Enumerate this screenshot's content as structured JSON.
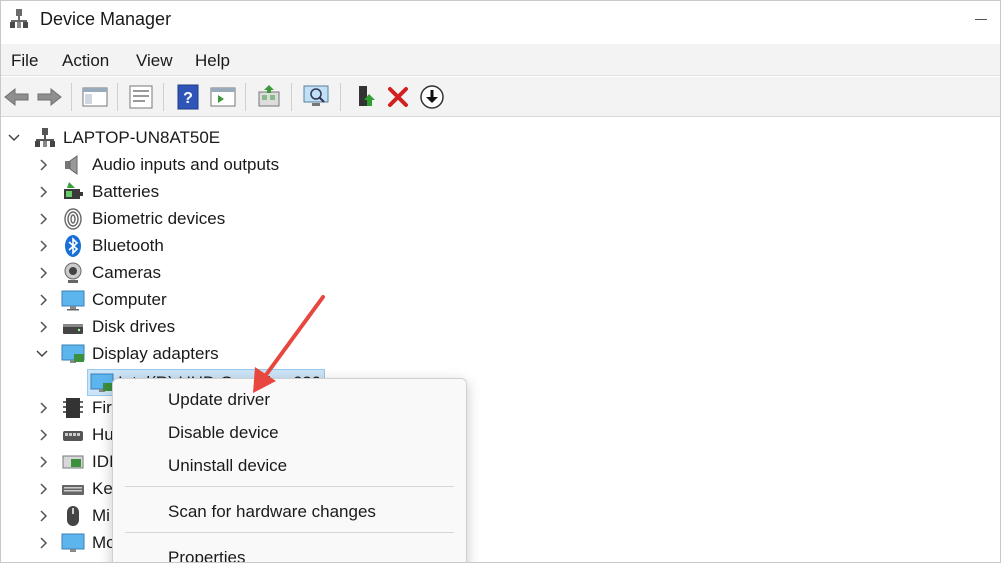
{
  "window": {
    "title": "Device Manager"
  },
  "menubar": {
    "items": [
      "File",
      "Action",
      "View",
      "Help"
    ]
  },
  "toolbar": {
    "buttons": [
      "back-icon",
      "forward-icon",
      "show-hide-console-tree-icon",
      "properties-icon",
      "help-icon",
      "action-pane-icon",
      "update-driver-software-icon",
      "scan-hardware-icon",
      "enable-device-icon",
      "uninstall-device-icon",
      "download-icon"
    ]
  },
  "tree": {
    "root": "LAPTOP-UN8AT50E",
    "categories": [
      {
        "label": "Audio inputs and outputs",
        "icon": "speaker-icon",
        "expanded": false
      },
      {
        "label": "Batteries",
        "icon": "battery-icon",
        "expanded": false
      },
      {
        "label": "Biometric devices",
        "icon": "fingerprint-icon",
        "expanded": false
      },
      {
        "label": "Bluetooth",
        "icon": "bluetooth-icon",
        "expanded": false
      },
      {
        "label": "Cameras",
        "icon": "camera-icon",
        "expanded": false
      },
      {
        "label": "Computer",
        "icon": "monitor-icon",
        "expanded": false
      },
      {
        "label": "Disk drives",
        "icon": "disk-drive-icon",
        "expanded": false
      },
      {
        "label": "Display adapters",
        "icon": "display-adapter-icon",
        "expanded": true
      },
      {
        "label": "Fir",
        "icon": "firmware-icon",
        "expanded": false
      },
      {
        "label": "Hu",
        "icon": "human-interface-icon",
        "expanded": false
      },
      {
        "label": "IDI",
        "icon": "ide-controller-icon",
        "expanded": false
      },
      {
        "label": "Ke",
        "icon": "keyboard-icon",
        "expanded": false
      },
      {
        "label": "Mi",
        "icon": "mouse-icon",
        "expanded": false
      },
      {
        "label": "Mo",
        "icon": "monitor-icon",
        "expanded": false
      }
    ],
    "child": {
      "label": "Intel(R) UHD Graphics 620"
    }
  },
  "context_menu": {
    "items": [
      "Update driver",
      "Disable device",
      "Uninstall device",
      "Scan for hardware changes",
      "Properties"
    ]
  },
  "colors": {
    "selection": "#cce4f7",
    "arrow": "#e8473f",
    "bluetooth": "#1a6fd6",
    "delete": "#d21f1f"
  }
}
